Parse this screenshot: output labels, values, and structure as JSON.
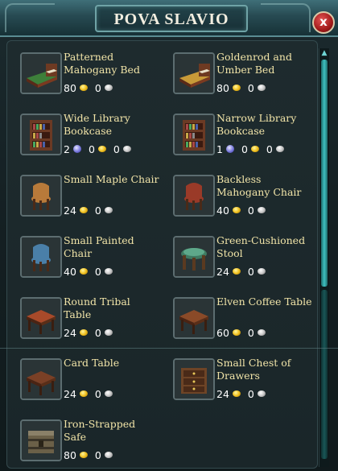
{
  "window": {
    "title": "POVA SLAVIO",
    "close_label": "x"
  },
  "items": [
    {
      "name": "Patterned Mahogany Bed",
      "price": [
        {
          "value": "80",
          "coin": "gold"
        },
        {
          "value": "0",
          "coin": "silver"
        }
      ],
      "icon": "bed-icon",
      "accent": "#3d7f3a"
    },
    {
      "name": "Goldenrod and Umber Bed",
      "price": [
        {
          "value": "80",
          "coin": "gold"
        },
        {
          "value": "0",
          "coin": "silver"
        }
      ],
      "icon": "bed-icon",
      "accent": "#c89a38"
    },
    {
      "name": "Wide Library Bookcase",
      "price": [
        {
          "value": "2",
          "coin": "blue"
        },
        {
          "value": "0",
          "coin": "gold"
        },
        {
          "value": "0",
          "coin": "silver"
        }
      ],
      "icon": "bookcase-icon",
      "accent": "#6b3a24"
    },
    {
      "name": "Narrow Library Bookcase",
      "price": [
        {
          "value": "1",
          "coin": "blue"
        },
        {
          "value": "0",
          "coin": "gold"
        },
        {
          "value": "0",
          "coin": "silver"
        }
      ],
      "icon": "bookcase-icon",
      "accent": "#6b3a24"
    },
    {
      "name": "Small Maple Chair",
      "price": [
        {
          "value": "24",
          "coin": "gold"
        },
        {
          "value": "0",
          "coin": "silver"
        }
      ],
      "icon": "chair-icon",
      "accent": "#b87a3a"
    },
    {
      "name": "Backless Mahogany Chair",
      "price": [
        {
          "value": "40",
          "coin": "gold"
        },
        {
          "value": "0",
          "coin": "silver"
        }
      ],
      "icon": "chair-icon",
      "accent": "#9a3a28"
    },
    {
      "name": "Small Painted Chair",
      "price": [
        {
          "value": "40",
          "coin": "gold"
        },
        {
          "value": "0",
          "coin": "silver"
        }
      ],
      "icon": "chair-icon",
      "accent": "#4a7fa8"
    },
    {
      "name": "Green-Cushioned Stool",
      "price": [
        {
          "value": "24",
          "coin": "gold"
        },
        {
          "value": "0",
          "coin": "silver"
        }
      ],
      "icon": "stool-icon",
      "accent": "#3f7a62"
    },
    {
      "name": "Round Tribal Table",
      "price": [
        {
          "value": "24",
          "coin": "gold"
        },
        {
          "value": "0",
          "coin": "silver"
        }
      ],
      "icon": "table-icon",
      "accent": "#a84a2a"
    },
    {
      "name": "Elven Coffee Table",
      "price": [
        {
          "value": "60",
          "coin": "gold"
        },
        {
          "value": "0",
          "coin": "silver"
        }
      ],
      "icon": "table-icon",
      "accent": "#8a4a28"
    },
    {
      "name": "Card Table",
      "price": [
        {
          "value": "24",
          "coin": "gold"
        },
        {
          "value": "0",
          "coin": "silver"
        }
      ],
      "icon": "table-icon",
      "accent": "#7a4026"
    },
    {
      "name": "Small Chest of Drawers",
      "price": [
        {
          "value": "24",
          "coin": "gold"
        },
        {
          "value": "0",
          "coin": "silver"
        }
      ],
      "icon": "drawers-icon",
      "accent": "#6e4426"
    },
    {
      "name": "Iron-Strapped Safe",
      "price": [
        {
          "value": "80",
          "coin": "gold"
        },
        {
          "value": "0",
          "coin": "silver"
        }
      ],
      "icon": "safe-icon",
      "accent": "#6b6048"
    }
  ]
}
